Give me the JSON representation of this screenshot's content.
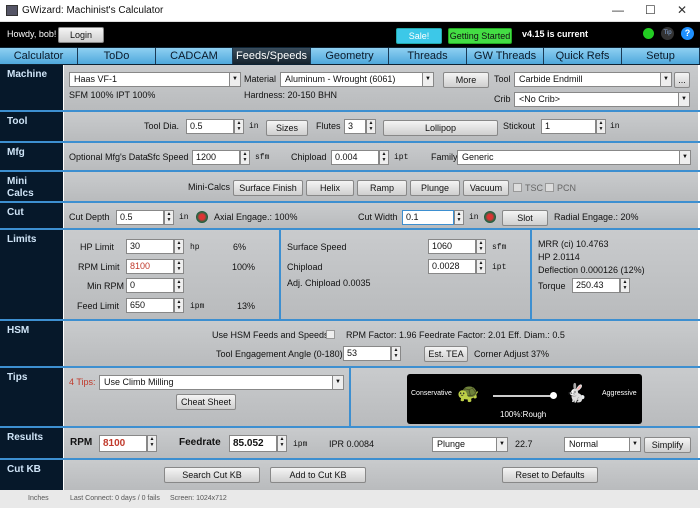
{
  "window": {
    "title": "GWizard: Machinist's Calculator",
    "min": "—",
    "max": "☐",
    "close": "✕"
  },
  "header": {
    "greeting": "Howdy, bob!",
    "login": "Login",
    "sale": "Sale!",
    "getting_started": "Getting Started",
    "version": "v4.15 is current",
    "tip": "Tip",
    "help": "?"
  },
  "tabs": [
    "Calculator",
    "ToDo",
    "CADCAM",
    "Feeds/Speeds",
    "Geometry",
    "Threads",
    "GW Threads",
    "Quick Refs",
    "Setup"
  ],
  "active_tab": "Feeds/Speeds",
  "machine": {
    "label": "Machine",
    "machine": "Haas VF-1",
    "sfm_ipt": "SFM 100%  IPT 100%",
    "material_label": "Material",
    "material": "Aluminum - Wrought (6061)",
    "more": "More",
    "hardness": "Hardness: 20-150 BHN",
    "tool_label": "Tool",
    "tool": "Carbide Endmill",
    "tool_more": "...",
    "crib_label": "Crib",
    "crib": "<No Crib>"
  },
  "tool": {
    "label": "Tool",
    "dia_label": "Tool Dia.",
    "dia": "0.5",
    "unit": "in",
    "sizes": "Sizes",
    "flutes_label": "Flutes",
    "flutes": "3",
    "lollipop": "Lollipop",
    "stickout_label": "Stickout",
    "stickout": "1"
  },
  "mfg": {
    "label": "Mfg",
    "optional": "Optional Mfg's Data:",
    "sfc_label": "Sfc Speed",
    "sfc": "1200",
    "sfm": "sfm",
    "chip_label": "Chipload",
    "chip": "0.004",
    "ipt": "ipt",
    "family_label": "Family:",
    "family": "Generic"
  },
  "mini": {
    "label": "Mini Calcs",
    "title": "Mini-Calcs",
    "buttons": [
      "Surface Finish",
      "Helix",
      "Ramp",
      "Plunge",
      "Vacuum"
    ],
    "tsc": "TSC",
    "pcn": "PCN"
  },
  "cut": {
    "label": "Cut",
    "depth_label": "Cut Depth",
    "depth": "0.5",
    "in": "in",
    "axial": "Axial Engage.: 100%",
    "width_label": "Cut Width",
    "width": "0.1",
    "slot": "Slot",
    "radial": "Radial Engage.: 20%"
  },
  "limits": {
    "label": "Limits",
    "hp_label": "HP Limit",
    "hp": "30",
    "hp_unit": "hp",
    "hp_pct": "6%",
    "rpm_label": "RPM Limit",
    "rpm": "8100",
    "rpm_pct": "100%",
    "minrpm_label": "Min RPM",
    "minrpm": "0",
    "feed_label": "Feed Limit",
    "feed": "650",
    "feed_unit": "ipm",
    "feed_pct": "13%",
    "ss_label": "Surface Speed",
    "ss": "1060",
    "ss_unit": "sfm",
    "cl_label": "Chipload",
    "cl": "0.0028",
    "cl_unit": "ipt",
    "adj": "Adj. Chipload 0.0035",
    "mrr": "MRR (ci) 10.4763",
    "hpv": "HP 2.0114",
    "defl": "Deflection 0.000126   (12%)",
    "torque_label": "Torque",
    "torque": "250.43"
  },
  "hsm": {
    "label": "HSM",
    "use": "Use HSM Feeds and Speeds",
    "factors": "RPM Factor: 1.96  Feedrate Factor: 2.01  Eff. Diam.: 0.5",
    "tea_label": "Tool Engagement Angle (0-180)",
    "tea": "53",
    "est": "Est. TEA",
    "corner": "Corner Adjust 37%"
  },
  "tips": {
    "label": "Tips",
    "count": "4 Tips:",
    "tip": "Use Climb Milling",
    "cheat": "Cheat Sheet",
    "conservative": "Conservative",
    "aggressive": "Aggressive",
    "slider_value": "100%:Rough",
    "slider_fraction": 1.0
  },
  "results": {
    "label": "Results",
    "rpm_label": "RPM",
    "rpm": "8100",
    "feed_label": "Feedrate",
    "feed": "85.052",
    "ipm": "ipm",
    "ipr": "IPR 0.0084",
    "mode": "Plunge",
    "mode_val": "22.7",
    "level": "Normal",
    "simplify": "Simplify"
  },
  "cutkb": {
    "label": "Cut KB",
    "search": "Search Cut KB",
    "add": "Add to Cut KB",
    "reset": "Reset to Defaults"
  },
  "status": {
    "units": "Inches",
    "connect": "Last Connect: 0 days / 0 fails",
    "screen": "Screen: 1024x712"
  },
  "colors": {
    "accent": "#3d8fd0",
    "tab": "#4fa8dc",
    "sale": "#3cc8e8",
    "getting_started": "#44dd44",
    "red_value": "#c0392b"
  }
}
